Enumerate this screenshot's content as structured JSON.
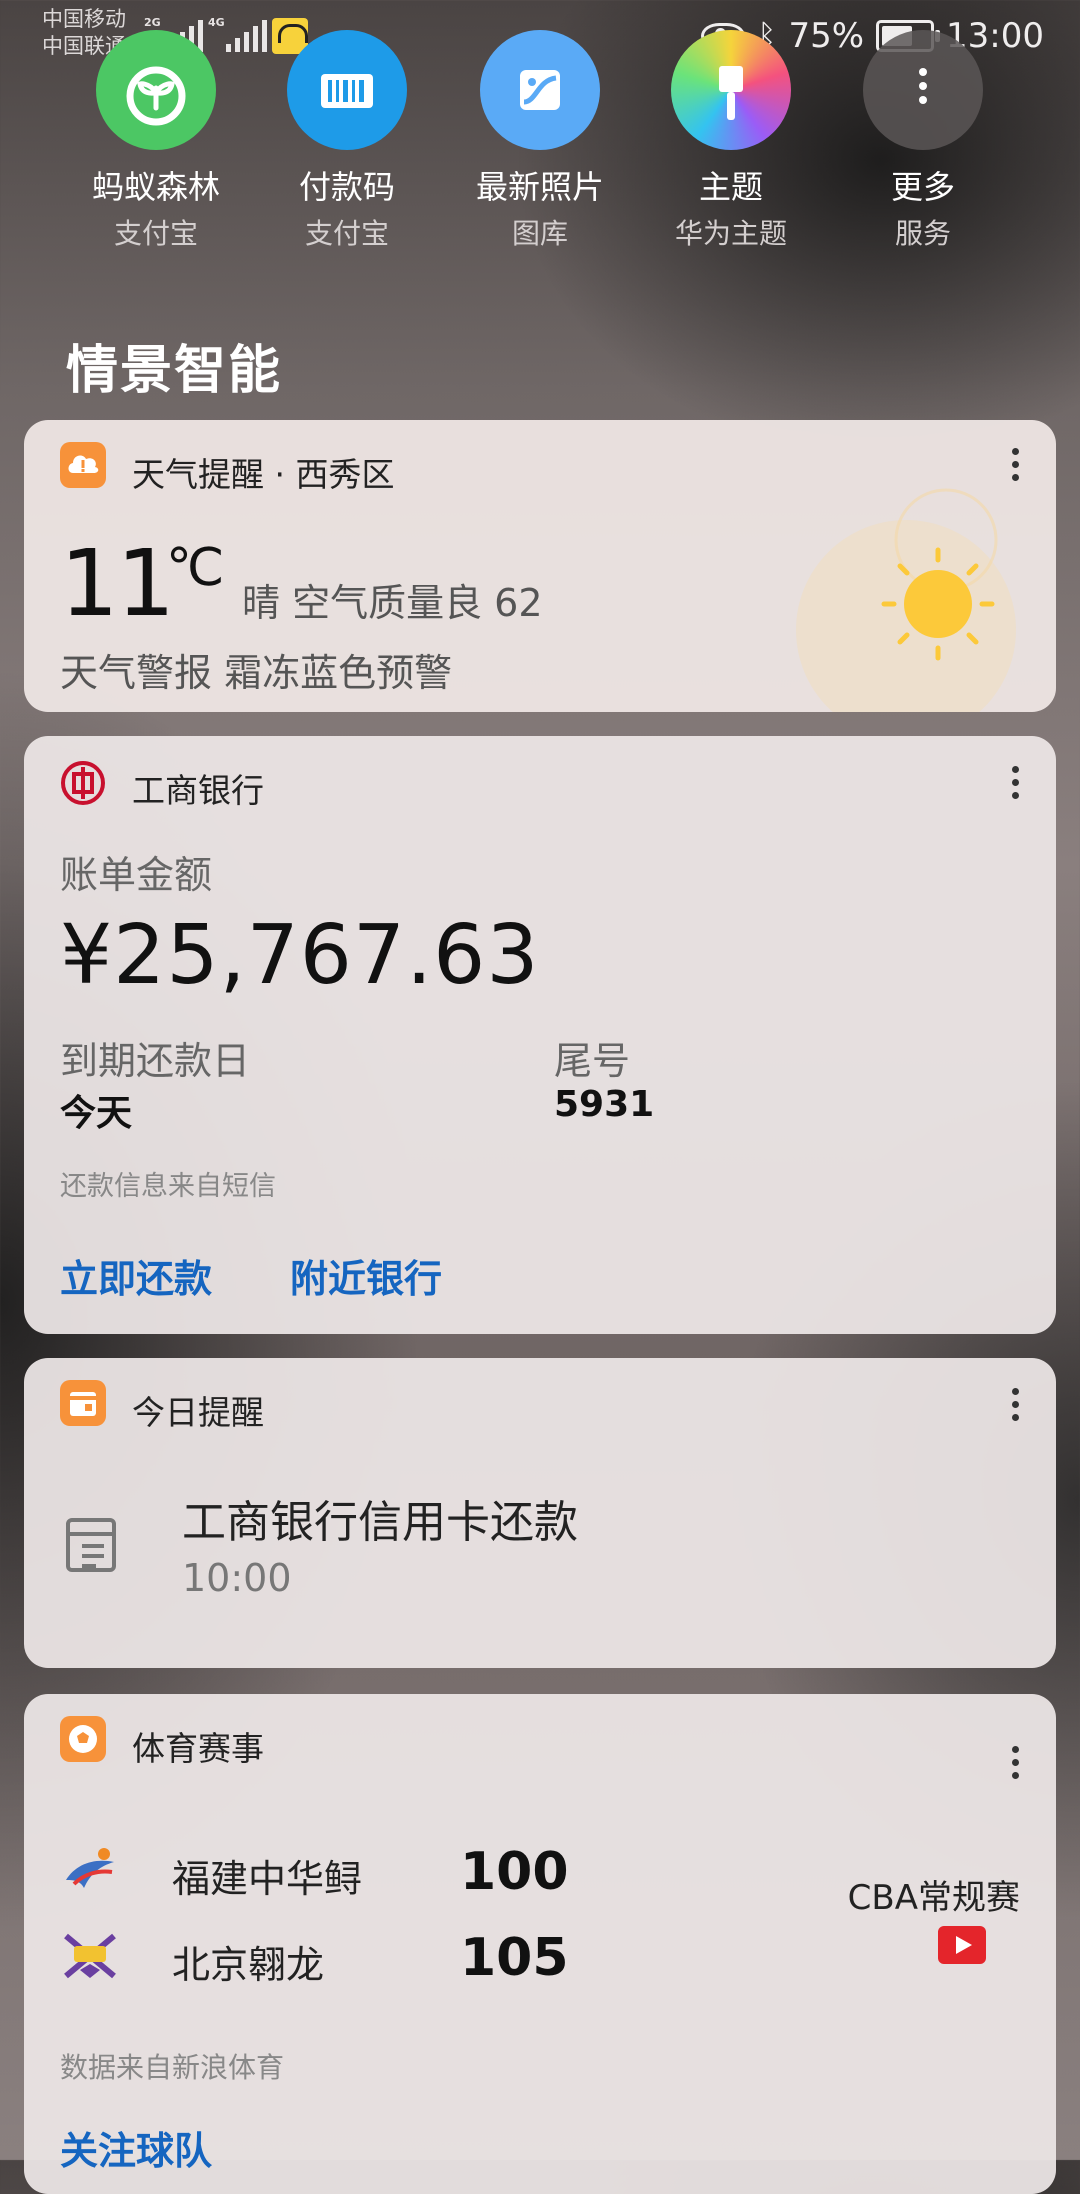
{
  "status_bar": {
    "carrier_1": "中国移动",
    "carrier_2": "中国联通",
    "sim1_network": "2G",
    "sim2_network": "4G",
    "battery_percent": "75%",
    "battery_level": 0.75,
    "time": "13:00",
    "icons": [
      "eye-comfort-icon",
      "bluetooth-icon",
      "battery-icon"
    ]
  },
  "shortcuts": [
    {
      "name": "蚂蚁森林",
      "sub": "支付宝",
      "color": "#4cc764",
      "icon": "sprout-icon"
    },
    {
      "name": "付款码",
      "sub": "支付宝",
      "color": "#1e9be8",
      "icon": "barcode-icon"
    },
    {
      "name": "最新照片",
      "sub": "图库",
      "color": "#5aaaf6",
      "icon": "photo-icon"
    },
    {
      "name": "主题",
      "sub": "华为主题",
      "color": "#f26aa7",
      "icon": "brush-icon"
    },
    {
      "name": "更多",
      "sub": "服务",
      "color": "#5b5757",
      "icon": "more-vertical-icon"
    }
  ],
  "section_title": "情景智能",
  "weather_card": {
    "title": "天气提醒 · 西秀区",
    "temperature": "11",
    "unit": "℃",
    "condition": "晴  空气质量良  62",
    "alert": "天气警报 霜冻蓝色预警",
    "accent": "#f7923a"
  },
  "bank_card": {
    "title": "工商银行",
    "amount_label": "账单金额",
    "amount": "¥25,767.63",
    "due_label": "到期还款日",
    "due_value": "今天",
    "tail_label": "尾号",
    "tail_value": "5931",
    "source": "还款信息来自短信",
    "action_pay": "立即还款",
    "action_nearby": "附近银行",
    "link_color": "#1565c0"
  },
  "reminder_card": {
    "title": "今日提醒",
    "item_title": "工商银行信用卡还款",
    "item_time": "10:00"
  },
  "sports_card": {
    "title": "体育赛事",
    "teams": [
      {
        "name": "福建中华鲟",
        "score": "100"
      },
      {
        "name": "北京翱龙",
        "score": "105"
      }
    ],
    "league": "CBA常规赛",
    "source": "数据来自新浪体育",
    "action_follow": "关注球队"
  }
}
